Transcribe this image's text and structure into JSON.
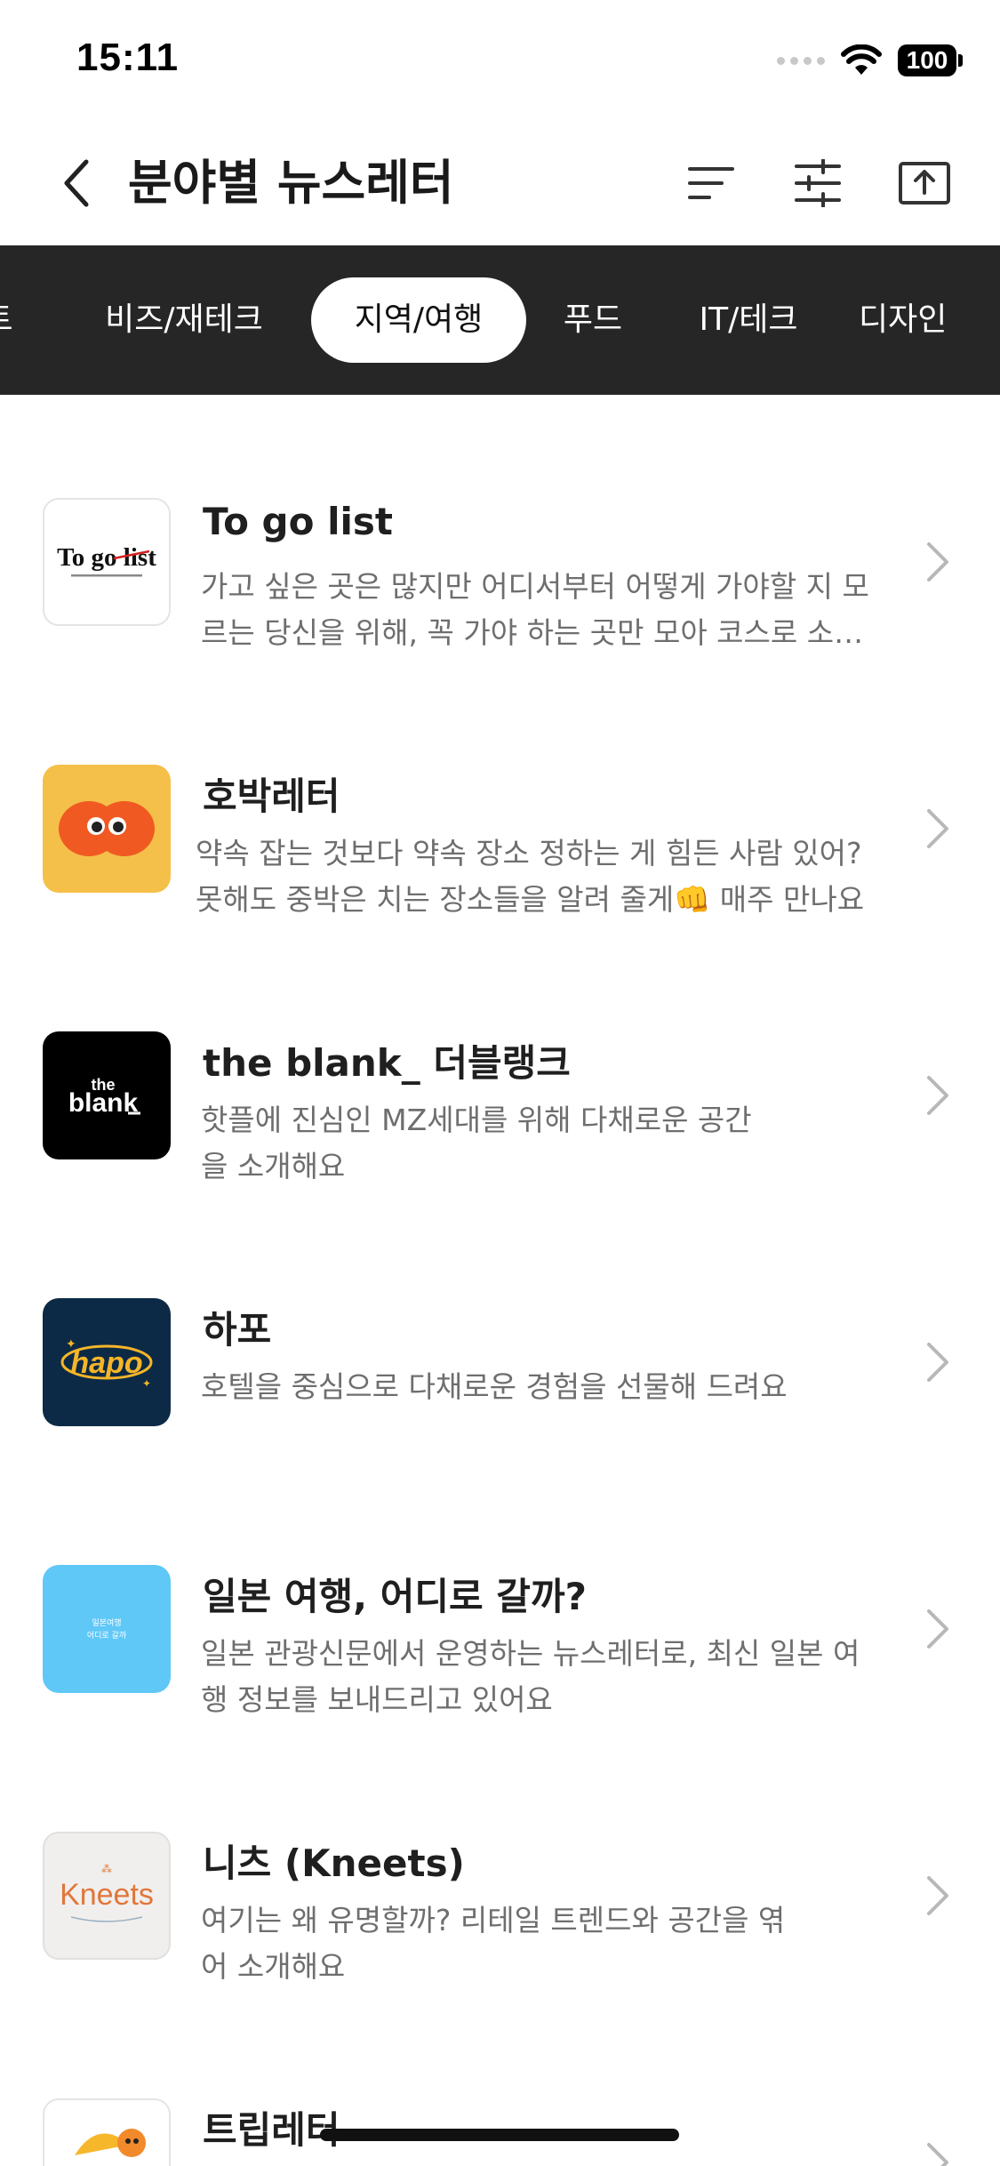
{
  "status": {
    "time": "15:11",
    "battery": "100"
  },
  "header": {
    "title": "분야별 뉴스레터",
    "back_icon": "chevron-left-icon",
    "sort_icon": "sort-icon",
    "filter_icon": "sliders-icon",
    "share_icon": "upload-icon"
  },
  "categories": {
    "partial": "트",
    "items": [
      "비즈/재테크",
      "지역/여행",
      "푸드",
      "IT/테크",
      "디자인"
    ],
    "selected": "지역/여행"
  },
  "newsletters": [
    {
      "title": "To go list",
      "desc": "가고 싶은 곳은 많지만 어디서부터 어떻게 가야할 지 모르는 당신을 위해, 꼭 가야 하는 곳만 모아 코스로 소개해요",
      "logo_text": "To go list"
    },
    {
      "title": "호박레터",
      "desc": "약속 잡는 것보다 약속 장소 정하는 게 힘든 사람 있어? 못해도 중박은 치는 장소들을 알려 줄게👊 매주 만나요",
      "logo_text": ""
    },
    {
      "title": "the blank_ 더블랭크",
      "desc": "핫플에 진심인 MZ세대를 위해 다채로운 공간을 소개해요",
      "logo_text": "the blank"
    },
    {
      "title": "하포",
      "desc": "호텔을 중심으로 다채로운 경험을 선물해 드려요",
      "logo_text": "hapo"
    },
    {
      "title": "일본 여행, 어디로 갈까?",
      "desc": "일본 관광신문에서 운영하는 뉴스레터로, 최신 일본 여행 정보를 보내드리고 있어요",
      "logo_text": "일본여행 어디로 갈까"
    },
    {
      "title": "니츠 (Kneets)",
      "desc": "여기는 왜 유명할까? 리테일 트렌드와 공간을 엮어 소개해요",
      "logo_text": "Kneets"
    },
    {
      "title": "트립레터",
      "desc": "",
      "logo_text": ""
    }
  ],
  "colors": {
    "category_bar": "#262626",
    "hobak_bg": "#f4c04a",
    "hobak_eyes": "#f05a22",
    "blank_bg": "#000000",
    "hapo_bg": "#0c2a45",
    "hapo_text": "#f5b529",
    "japan_bg": "#5fc8f7",
    "kneets_text": "#e1763a"
  }
}
